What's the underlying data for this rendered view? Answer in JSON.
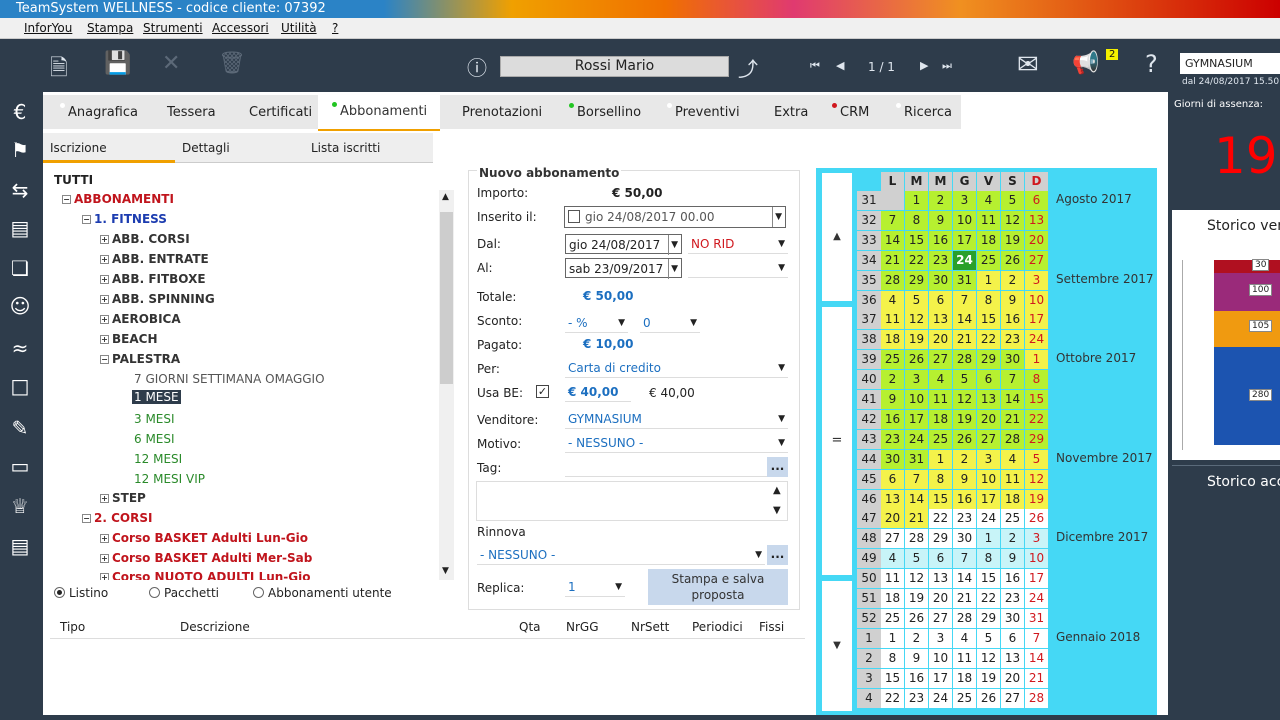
{
  "app": {
    "title": "TeamSystem WELLNESS - codice cliente: 07392"
  },
  "menu": [
    "InforYou",
    "Stampa",
    "Strumenti",
    "Accessori",
    "Utilità",
    "?"
  ],
  "toolbar": {
    "client_name": "Rossi Mario",
    "page": "1 / 1",
    "notifications": "2",
    "gym": "GYMNASIUM",
    "gym_date": "dal 24/08/2017 15.50"
  },
  "tabs": [
    {
      "label": "Anagrafica",
      "dot": "#ffffff"
    },
    {
      "label": "Tessera",
      "dot": ""
    },
    {
      "label": "Certificati",
      "dot": ""
    },
    {
      "label": "Abbonamenti",
      "dot": "#22c522"
    },
    {
      "label": "Prenotazioni",
      "dot": ""
    },
    {
      "label": "Borsellino",
      "dot": "#22c522"
    },
    {
      "label": "Preventivi",
      "dot": "#ffffff"
    },
    {
      "label": "Extra",
      "dot": ""
    },
    {
      "label": "CRM",
      "dot": "#d0181e"
    },
    {
      "label": "Ricerca",
      "dot": "#ffffff"
    }
  ],
  "subtabs": [
    "Iscrizione",
    "Dettagli",
    "Lista iscritti"
  ],
  "tree": {
    "root": "TUTTI",
    "nodes": [
      "ABBONAMENTI",
      "1. FITNESS",
      "ABB. CORSI",
      "ABB. ENTRATE",
      "ABB. FITBOXE",
      "ABB. SPINNING",
      "AEROBICA",
      "BEACH",
      "PALESTRA",
      "7 GIORNI SETTIMANA OMAGGIO",
      "1 MESE",
      "3 MESI",
      "6 MESI",
      "12 MESI",
      "12 MESI VIP",
      "STEP",
      "2. CORSI",
      "Corso BASKET Adulti Lun-Gio",
      "Corso BASKET Adulti Mer-Sab",
      "Corso NUOTO ADULTI Lun-Gio"
    ]
  },
  "radios": [
    "Listino",
    "Pacchetti",
    "Abbonamenti utente"
  ],
  "grid_headers": [
    "Tipo",
    "Descrizione",
    "Qta",
    "NrGG",
    "NrSett",
    "Periodici",
    "Fissi"
  ],
  "form": {
    "title": "Nuovo abbonamento",
    "importo_label": "Importo:",
    "importo": "€ 50,00",
    "inserito_label": "Inserito il:",
    "inserito_day": "gio",
    "inserito": "24/08/2017 00.00",
    "dal_label": "Dal:",
    "dal_day": "gio",
    "dal": "24/08/2017",
    "rid": "NO RID",
    "al_label": "Al:",
    "al_day": "sab",
    "al": "23/09/2017",
    "totale_label": "Totale:",
    "totale": "€ 50,00",
    "sconto_label": "Sconto:",
    "sconto_type": "- %",
    "sconto_val": "0",
    "pagato_label": "Pagato:",
    "pagato": "€ 10,00",
    "per_label": "Per:",
    "per": "Carta di credito",
    "usabe_label": "Usa BE:",
    "usabe_val": "€ 40,00",
    "usabe_avail": "€ 40,00",
    "venditore_label": "Venditore:",
    "venditore": "GYMNASIUM",
    "motivo_label": "Motivo:",
    "motivo": "- NESSUNO -",
    "tag_label": "Tag:",
    "rinnova_label": "Rinnova",
    "rinnova": "- NESSUNO -",
    "replica_label": "Replica:",
    "replica": "1",
    "save_button": "Stampa e salva proposta",
    "ellipsis": "..."
  },
  "calendar": {
    "headers": [
      "L",
      "M",
      "M",
      "G",
      "V",
      "S",
      "D"
    ],
    "weeks": [
      {
        "wk": "31",
        "days": [
          "",
          "1",
          "2",
          "3",
          "4",
          "5",
          "6"
        ],
        "month": "Agosto 2017"
      },
      {
        "wk": "32",
        "days": [
          "7",
          "8",
          "9",
          "10",
          "11",
          "12",
          "13"
        ],
        "month": ""
      },
      {
        "wk": "33",
        "days": [
          "14",
          "15",
          "16",
          "17",
          "18",
          "19",
          "20"
        ],
        "month": ""
      },
      {
        "wk": "34",
        "days": [
          "21",
          "22",
          "23",
          "24",
          "25",
          "26",
          "27"
        ],
        "month": ""
      },
      {
        "wk": "35",
        "days": [
          "28",
          "29",
          "30",
          "31",
          "1",
          "2",
          "3"
        ],
        "month": "Settembre 2017"
      },
      {
        "wk": "36",
        "days": [
          "4",
          "5",
          "6",
          "7",
          "8",
          "9",
          "10"
        ],
        "month": ""
      },
      {
        "wk": "37",
        "days": [
          "11",
          "12",
          "13",
          "14",
          "15",
          "16",
          "17"
        ],
        "month": ""
      },
      {
        "wk": "38",
        "days": [
          "18",
          "19",
          "20",
          "21",
          "22",
          "23",
          "24"
        ],
        "month": ""
      },
      {
        "wk": "39",
        "days": [
          "25",
          "26",
          "27",
          "28",
          "29",
          "30",
          "1"
        ],
        "month": "Ottobre 2017"
      },
      {
        "wk": "40",
        "days": [
          "2",
          "3",
          "4",
          "5",
          "6",
          "7",
          "8"
        ],
        "month": ""
      },
      {
        "wk": "41",
        "days": [
          "9",
          "10",
          "11",
          "12",
          "13",
          "14",
          "15"
        ],
        "month": ""
      },
      {
        "wk": "42",
        "days": [
          "16",
          "17",
          "18",
          "19",
          "20",
          "21",
          "22"
        ],
        "month": ""
      },
      {
        "wk": "43",
        "days": [
          "23",
          "24",
          "25",
          "26",
          "27",
          "28",
          "29"
        ],
        "month": ""
      },
      {
        "wk": "44",
        "days": [
          "30",
          "31",
          "1",
          "2",
          "3",
          "4",
          "5"
        ],
        "month": "Novembre 2017"
      },
      {
        "wk": "45",
        "days": [
          "6",
          "7",
          "8",
          "9",
          "10",
          "11",
          "12"
        ],
        "month": ""
      },
      {
        "wk": "46",
        "days": [
          "13",
          "14",
          "15",
          "16",
          "17",
          "18",
          "19"
        ],
        "month": ""
      },
      {
        "wk": "47",
        "days": [
          "20",
          "21",
          "22",
          "23",
          "24",
          "25",
          "26"
        ],
        "month": ""
      },
      {
        "wk": "48",
        "days": [
          "27",
          "28",
          "29",
          "30",
          "1",
          "2",
          "3"
        ],
        "month": "Dicembre 2017"
      },
      {
        "wk": "49",
        "days": [
          "4",
          "5",
          "6",
          "7",
          "8",
          "9",
          "10"
        ],
        "month": ""
      },
      {
        "wk": "50",
        "days": [
          "11",
          "12",
          "13",
          "14",
          "15",
          "16",
          "17"
        ],
        "month": ""
      },
      {
        "wk": "51",
        "days": [
          "18",
          "19",
          "20",
          "21",
          "22",
          "23",
          "24"
        ],
        "month": ""
      },
      {
        "wk": "52",
        "days": [
          "25",
          "26",
          "27",
          "28",
          "29",
          "30",
          "31"
        ],
        "month": ""
      },
      {
        "wk": "1",
        "days": [
          "1",
          "2",
          "3",
          "4",
          "5",
          "6",
          "7"
        ],
        "month": "Gennaio 2018"
      },
      {
        "wk": "2",
        "days": [
          "8",
          "9",
          "10",
          "11",
          "12",
          "13",
          "14"
        ],
        "month": ""
      },
      {
        "wk": "3",
        "days": [
          "15",
          "16",
          "17",
          "18",
          "19",
          "20",
          "21"
        ],
        "month": ""
      },
      {
        "wk": "4",
        "days": [
          "22",
          "23",
          "24",
          "25",
          "26",
          "27",
          "28"
        ],
        "month": ""
      }
    ],
    "today": "24",
    "nav": [
      "▲",
      "=",
      "▼"
    ]
  },
  "right": {
    "assenza_label": "Giorni di assenza:",
    "assenza": "19",
    "storico_vendite": "Storico ven",
    "storico_acc": "Storico acc",
    "bars": [
      "30",
      "100",
      "105",
      "280"
    ]
  },
  "colors": {
    "dark": "#2e3c4b",
    "period": "#b6f030",
    "weekday": "#f4f24a",
    "other": "#c8f4f8",
    "today": "#2aa02a",
    "calbg": "#45d8f5"
  }
}
